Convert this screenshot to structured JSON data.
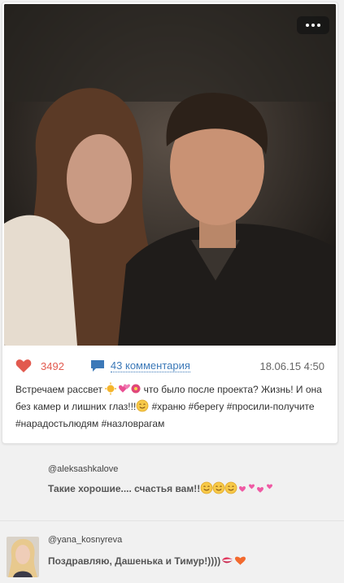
{
  "post": {
    "likes": "3492",
    "comments_link": "43 комментария",
    "date": "18.06.15 4:50",
    "caption_part1": "Встречаем рассвет ",
    "caption_part2": " что было после проекта? Жизнь! И она без камер и лишних глаз!!!",
    "caption_part3": " #храню #берегу #просили-получите #нарадостьлюдям #назловрагам"
  },
  "comments": [
    {
      "author": "@aleksashkalove",
      "text": "Такие хорошие.... счастья вам!!"
    },
    {
      "author": "@yana_kosnyreva",
      "text": "Поздравляю, Дашенька и Тимур!))))"
    }
  ],
  "colors": {
    "like": "#e25a4f",
    "comment_link": "#3c79b8",
    "background": "#f1f1f1"
  },
  "icons": [
    "heart-icon",
    "speech-bubble-icon",
    "more-dots-icon"
  ]
}
